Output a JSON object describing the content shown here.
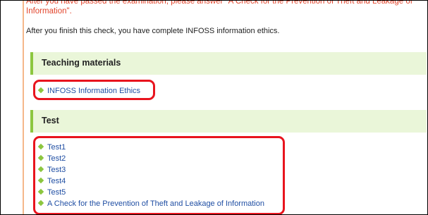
{
  "intro_text": "After you have passed the examination, please answer \"A Check for the Prevention of Theft and Leakage of Information\".",
  "after_text": "After you finish this check, you have complete INFOSS information ethics.",
  "teaching": {
    "heading": "Teaching materials",
    "items": [
      {
        "label": "INFOSS Information Ethics"
      }
    ]
  },
  "test": {
    "heading": "Test",
    "items": [
      {
        "label": "Test1"
      },
      {
        "label": "Test2"
      },
      {
        "label": "Test3"
      },
      {
        "label": "Test4"
      },
      {
        "label": "Test5"
      },
      {
        "label": "A Check for the Prevention of Theft and Leakage of Information"
      }
    ]
  },
  "colors": {
    "highlight_box": "#e8141e",
    "section_bg": "#eaf6d9",
    "accent_green": "#8cc63f",
    "link": "#1f4ea3",
    "warning_text": "#e2452c"
  }
}
